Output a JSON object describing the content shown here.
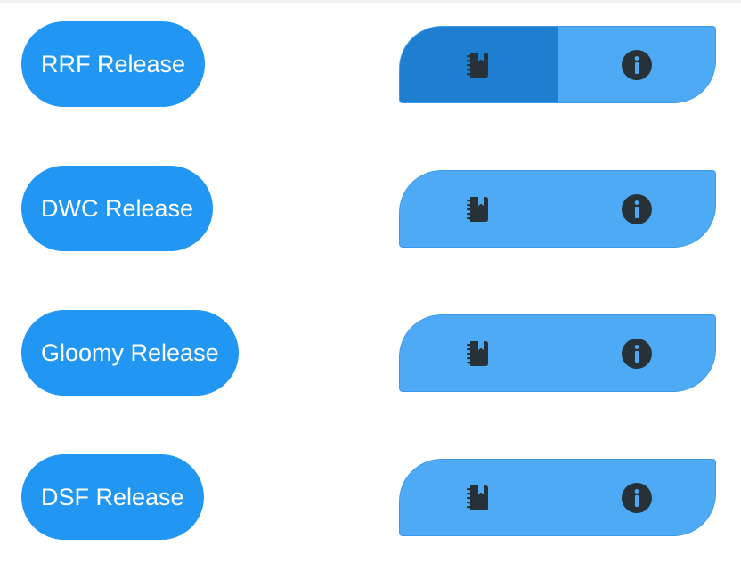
{
  "releases": [
    {
      "label": "RRF Release",
      "changelog_icon": "notebook-icon",
      "info_icon": "info-circle-icon",
      "active_segment": "changelog"
    },
    {
      "label": "DWC Release",
      "changelog_icon": "notebook-icon",
      "info_icon": "info-circle-icon",
      "active_segment": ""
    },
    {
      "label": "Gloomy Release",
      "changelog_icon": "notebook-icon",
      "info_icon": "info-circle-icon",
      "active_segment": ""
    },
    {
      "label": "DSF Release",
      "changelog_icon": "notebook-icon",
      "info_icon": "info-circle-icon",
      "active_segment": ""
    }
  ],
  "colors": {
    "pill": "#2196f3",
    "segment": "#4eaaf4",
    "segment_active": "#1e7fd0",
    "icon": "#263238"
  }
}
